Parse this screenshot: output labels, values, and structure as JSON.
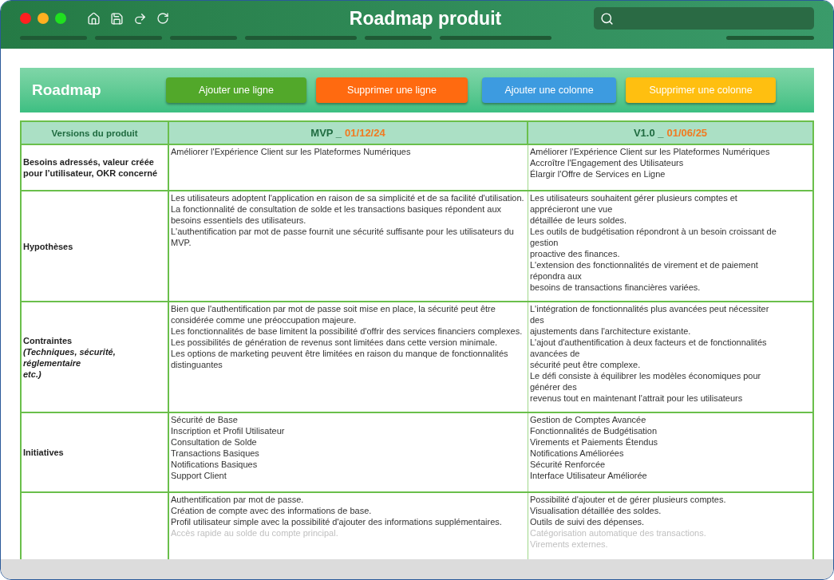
{
  "window": {
    "title": "Roadmap produit"
  },
  "sheet": {
    "title": "Roadmap",
    "buttons": [
      {
        "label": "Ajouter une ligne",
        "color": "#52a82a"
      },
      {
        "label": "Supprimer une ligne",
        "color": "#ff6a10"
      },
      {
        "label": "Ajouter une colonne",
        "color": "#3d9be0"
      },
      {
        "label": "Supprimer une colonne",
        "color": "#ffbf10"
      }
    ]
  },
  "table": {
    "corner": "Versions du produit",
    "columns": [
      {
        "version": "MVP _",
        "date": "01/12/24"
      },
      {
        "version": "V1.0 _",
        "date": "01/06/25"
      }
    ],
    "rows": [
      {
        "label": [
          "Besoins adressés, valeur créée pour l’utilisateur, OKR concerné"
        ],
        "cells": [
          [
            {
              "text": "Améliorer l'Expérience Client sur les Plateformes Numériques",
              "faded": false
            }
          ],
          [
            {
              "text": "Améliorer l'Expérience Client sur les Plateformes Numériques",
              "faded": false
            },
            {
              "text": "Accroître l'Engagement des Utilisateurs",
              "faded": false
            },
            {
              "text": "Élargir l'Offre de Services en Ligne",
              "faded": false
            }
          ]
        ]
      },
      {
        "label": [
          "Hypothèses"
        ],
        "cells": [
          [
            {
              "text": "Les utilisateurs adoptent l'application en raison de sa simplicité et de sa facilité d'utilisation.",
              "faded": false
            },
            {
              "text": "La fonctionnalité de consultation de solde et les transactions basiques répondent aux besoins essentiels des utilisateurs.",
              "faded": false
            },
            {
              "text": "L'authentification par mot de passe fournit une sécurité suffisante pour les utilisateurs du MVP.",
              "faded": false
            }
          ],
          [
            {
              "text": "Les utilisateurs souhaitent gérer plusieurs comptes et",
              "faded": false
            },
            {
              "text": "apprécieront une vue",
              "faded": false
            },
            {
              "text": "détaillée de leurs soldes.",
              "faded": false
            },
            {
              "text": "Les outils de budgétisation répondront à un besoin croissant de",
              "faded": false
            },
            {
              "text": "gestion",
              "faded": false
            },
            {
              "text": "proactive des finances.",
              "faded": false
            },
            {
              "text": "L'extension des fonctionnalités de virement et de paiement",
              "faded": false
            },
            {
              "text": "répondra aux",
              "faded": false
            },
            {
              "text": "besoins de transactions financières variées.",
              "faded": false
            }
          ]
        ]
      },
      {
        "label": [
          "Contraintes",
          "*(Techniques, sécurité,*",
          "*réglementaire*",
          "*etc.)*"
        ],
        "cells": [
          [
            {
              "text": "Bien que l'authentification par mot de passe soit mise en place, la sécurité peut être considérée comme une préoccupation majeure.",
              "faded": false
            },
            {
              "text": "Les fonctionnalités de base limitent la possibilité d'offrir des services financiers complexes.",
              "faded": false
            },
            {
              "text": "Les possibilités de génération de revenus sont limitées dans cette version minimale.",
              "faded": false
            },
            {
              "text": "Les options de marketing peuvent être limitées en raison du manque de fonctionnalités distinguantes",
              "faded": false
            }
          ],
          [
            {
              "text": "L'intégration de fonctionnalités plus avancées peut nécessiter",
              "faded": false
            },
            {
              "text": "des",
              "faded": false
            },
            {
              "text": "ajustements dans l'architecture existante.",
              "faded": false
            },
            {
              "text": "L'ajout d'authentification à deux facteurs et de fonctionnalités",
              "faded": false
            },
            {
              "text": "avancées de",
              "faded": false
            },
            {
              "text": "sécurité peut être complexe.",
              "faded": false
            },
            {
              "text": "Le défi consiste à équilibrer les modèles économiques pour",
              "faded": false
            },
            {
              "text": "générer des",
              "faded": false
            },
            {
              "text": "revenus tout en maintenant l'attrait pour les utilisateurs",
              "faded": false
            }
          ]
        ]
      },
      {
        "label": [
          "Initiatives"
        ],
        "cells": [
          [
            {
              "text": "Sécurité de Base",
              "faded": false
            },
            {
              "text": "Inscription et Profil Utilisateur",
              "faded": false
            },
            {
              "text": "Consultation de Solde",
              "faded": false
            },
            {
              "text": "Transactions Basiques",
              "faded": false
            },
            {
              "text": "Notifications Basiques",
              "faded": false
            },
            {
              "text": "Support Client",
              "faded": false
            }
          ],
          [
            {
              "text": "Gestion de Comptes Avancée",
              "faded": false
            },
            {
              "text": "Fonctionnalités de Budgétisation",
              "faded": false
            },
            {
              "text": "Virements et Paiements Étendus",
              "faded": false
            },
            {
              "text": "Notifications Améliorées",
              "faded": false
            },
            {
              "text": "Sécurité Renforcée",
              "faded": false
            },
            {
              "text": "Interface Utilisateur Améliorée",
              "faded": false
            }
          ]
        ]
      },
      {
        "cells": [
          [
            {
              "text": "Authentification par mot de passe.",
              "faded": false
            },
            {
              "text": "Création de compte avec des informations de base.",
              "faded": false
            },
            {
              "text": "Profil utilisateur simple avec la possibilité d'ajouter des informations supplémentaires.",
              "faded": false
            },
            {
              "text": "Accès rapide au solde du compte principal.",
              "faded": true
            }
          ],
          [
            {
              "text": "Possibilité d'ajouter et de gérer plusieurs comptes.",
              "faded": false
            },
            {
              "text": "Visualisation détaillée des soldes.",
              "faded": false
            },
            {
              "text": "Outils de suivi des dépenses.",
              "faded": false
            },
            {
              "text": "Catégorisation automatique des transactions.",
              "faded": true
            },
            {
              "text": "Virements externes.",
              "faded": true
            }
          ]
        ]
      }
    ]
  }
}
